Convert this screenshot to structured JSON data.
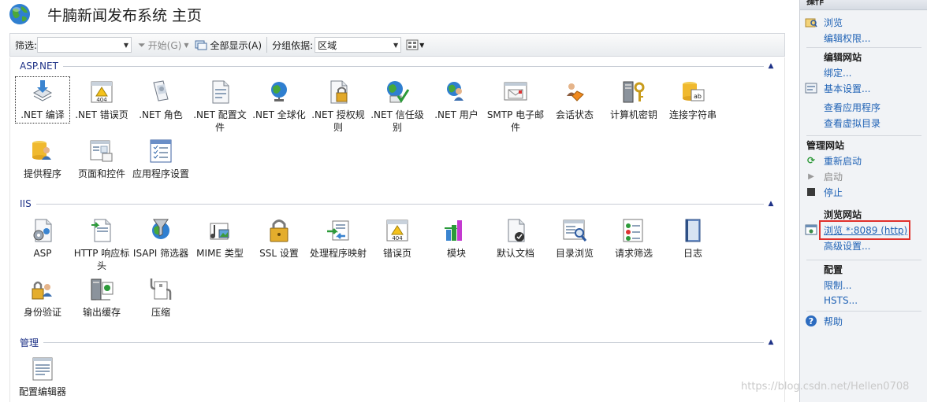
{
  "title": {
    "text": "牛腩新闻发布系统 主页"
  },
  "toolbar": {
    "filter_label": "筛选:",
    "filter_value": "",
    "start_label": "开始(G)",
    "show_all_label": "全部显示(A)",
    "group_label": "分组依据:",
    "group_value": "区域"
  },
  "groups": [
    {
      "title": "ASP.NET",
      "items": [
        {
          "label": ".NET 编译",
          "icon": "download-arrow-icon"
        },
        {
          "label": ".NET 错误页",
          "icon": "404-page-icon"
        },
        {
          "label": ".NET 角色",
          "icon": "roles-icon"
        },
        {
          "label": ".NET 配置文件",
          "icon": "config-file-icon"
        },
        {
          "label": ".NET 全球化",
          "icon": "globe-icon"
        },
        {
          "label": ".NET 授权规则",
          "icon": "lock-doc-icon"
        },
        {
          "label": ".NET 信任级别",
          "icon": "trust-globe-icon"
        },
        {
          "label": ".NET 用户",
          "icon": "users-icon"
        },
        {
          "label": "SMTP 电子邮件",
          "icon": "email-icon"
        },
        {
          "label": "会话状态",
          "icon": "session-state-icon"
        },
        {
          "label": "计算机密钥",
          "icon": "machine-key-icon"
        },
        {
          "label": "连接字符串",
          "icon": "connection-string-icon"
        },
        {
          "label": "提供程序",
          "icon": "provider-icon"
        },
        {
          "label": "页面和控件",
          "icon": "pages-controls-icon"
        },
        {
          "label": "应用程序设置",
          "icon": "app-settings-icon"
        }
      ]
    },
    {
      "title": "IIS",
      "items": [
        {
          "label": "ASP",
          "icon": "asp-icon"
        },
        {
          "label": "HTTP 响应标头",
          "icon": "http-header-icon"
        },
        {
          "label": "ISAPI 筛选器",
          "icon": "isapi-filter-icon"
        },
        {
          "label": "MIME 类型",
          "icon": "mime-icon"
        },
        {
          "label": "SSL 设置",
          "icon": "ssl-lock-icon"
        },
        {
          "label": "处理程序映射",
          "icon": "handler-mapping-icon"
        },
        {
          "label": "错误页",
          "icon": "error-page-icon"
        },
        {
          "label": "模块",
          "icon": "modules-icon"
        },
        {
          "label": "默认文档",
          "icon": "default-doc-icon"
        },
        {
          "label": "目录浏览",
          "icon": "dir-browse-icon"
        },
        {
          "label": "请求筛选",
          "icon": "request-filter-icon"
        },
        {
          "label": "日志",
          "icon": "log-book-icon"
        },
        {
          "label": "身份验证",
          "icon": "auth-icon"
        },
        {
          "label": "输出缓存",
          "icon": "output-cache-icon"
        },
        {
          "label": "压缩",
          "icon": "compression-icon"
        }
      ]
    },
    {
      "title": "管理",
      "items": [
        {
          "label": "配置编辑器",
          "icon": "config-editor-icon"
        }
      ]
    }
  ],
  "actions": {
    "header": "操作",
    "browse": "浏览",
    "edit_perms": "编辑权限...",
    "edit_site_title": "编辑网站",
    "bindings": "绑定...",
    "basic_settings": "基本设置...",
    "view_apps": "查看应用程序",
    "view_vdirs": "查看虚拟目录",
    "manage_site_title": "管理网站",
    "restart": "重新启动",
    "start": "启动",
    "stop": "停止",
    "browse_site_title": "浏览网站",
    "browse_port": "浏览 *:8089 (http)",
    "advanced_settings": "高级设置...",
    "config_title": "配置",
    "limits": "限制...",
    "hsts": "HSTS...",
    "help": "帮助"
  },
  "watermark": "https://blog.csdn.net/Hellen0708"
}
